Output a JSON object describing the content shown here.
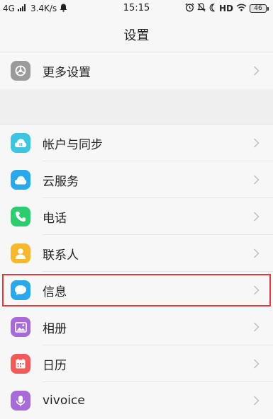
{
  "status_bar": {
    "network": "4G",
    "speed": "3.4K/s",
    "time": "15:15",
    "hd_label": "HD",
    "battery": "46"
  },
  "title": "设置",
  "sections": [
    {
      "items": [
        {
          "label": "更多设置",
          "icon": "gear-icon",
          "color": "#9a9a9a"
        }
      ]
    },
    {
      "items": [
        {
          "label": "帐户与同步",
          "icon": "account-sync-icon",
          "color": "#3cc4e0"
        },
        {
          "label": "云服务",
          "icon": "cloud-icon",
          "color": "#2aa8ea"
        },
        {
          "label": "电话",
          "icon": "phone-icon",
          "color": "#2ecc71"
        },
        {
          "label": "联系人",
          "icon": "contacts-icon",
          "color": "#f5b82e"
        },
        {
          "label": "信息",
          "icon": "message-icon",
          "color": "#2aa8ea",
          "highlighted": true
        },
        {
          "label": "相册",
          "icon": "gallery-icon",
          "color": "#a66bd6"
        },
        {
          "label": "日历",
          "icon": "calendar-icon",
          "color": "#ef5a5a"
        },
        {
          "label": "vivoice",
          "icon": "microphone-icon",
          "color": "#a66bd6"
        }
      ]
    }
  ],
  "colors": {
    "highlight_border": "#e0393e",
    "background": "#f2f2f2"
  }
}
